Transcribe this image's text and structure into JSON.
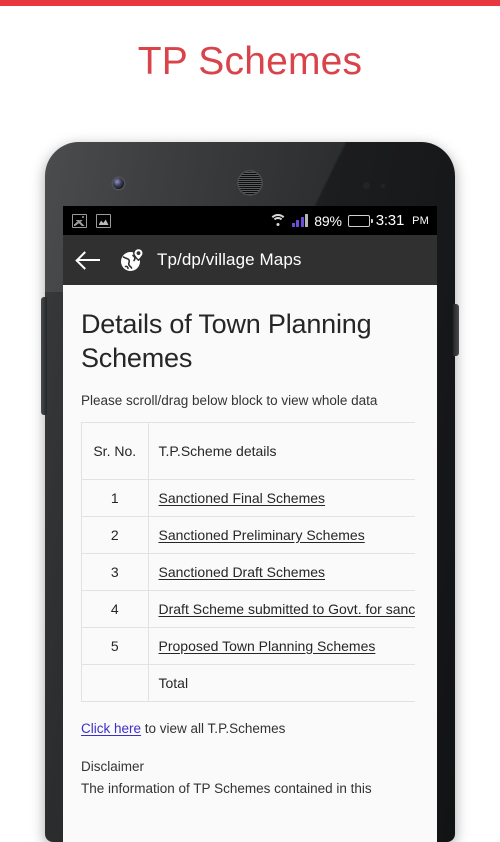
{
  "page": {
    "title": "TP Schemes",
    "accent_color": "#e8383d",
    "title_color": "#d9434a"
  },
  "phone": {
    "statusbar": {
      "notification_icons": [
        "photo-icon",
        "gallery-icon"
      ],
      "wifi": "wifi-icon",
      "signal": "signal-bars-icon",
      "battery_percent": "89%",
      "battery": "battery-icon",
      "time": "3:31",
      "ampm": "PM"
    },
    "appbar": {
      "back": "back-arrow-icon",
      "app_icon": "globe-map-pin-icon",
      "title": "Tp/dp/village Maps"
    }
  },
  "webpage": {
    "heading": "Details of Town Planning Schemes",
    "note": "Please scroll/drag below block to view whole data",
    "table": {
      "headers": [
        "Sr. No.",
        "T.P.Scheme details"
      ],
      "rows": [
        {
          "sr": "1",
          "detail": "Sanctioned Final Schemes"
        },
        {
          "sr": "2",
          "detail": "Sanctioned Preliminary Schemes"
        },
        {
          "sr": "3",
          "detail": "Sanctioned Draft Schemes"
        },
        {
          "sr": "4",
          "detail": "Draft Scheme submitted to Govt. for sanction"
        },
        {
          "sr": "5",
          "detail": "Proposed Town Planning Schemes"
        }
      ],
      "total_row": {
        "sr": "",
        "detail": "Total"
      }
    },
    "link_line": {
      "link_text": "Click here",
      "rest_text": " to view all T.P.Schemes",
      "link_color": "#3c2ecb"
    },
    "disclaimer_title": "Disclaimer",
    "disclaimer_body": "The information of TP Schemes contained in this"
  }
}
